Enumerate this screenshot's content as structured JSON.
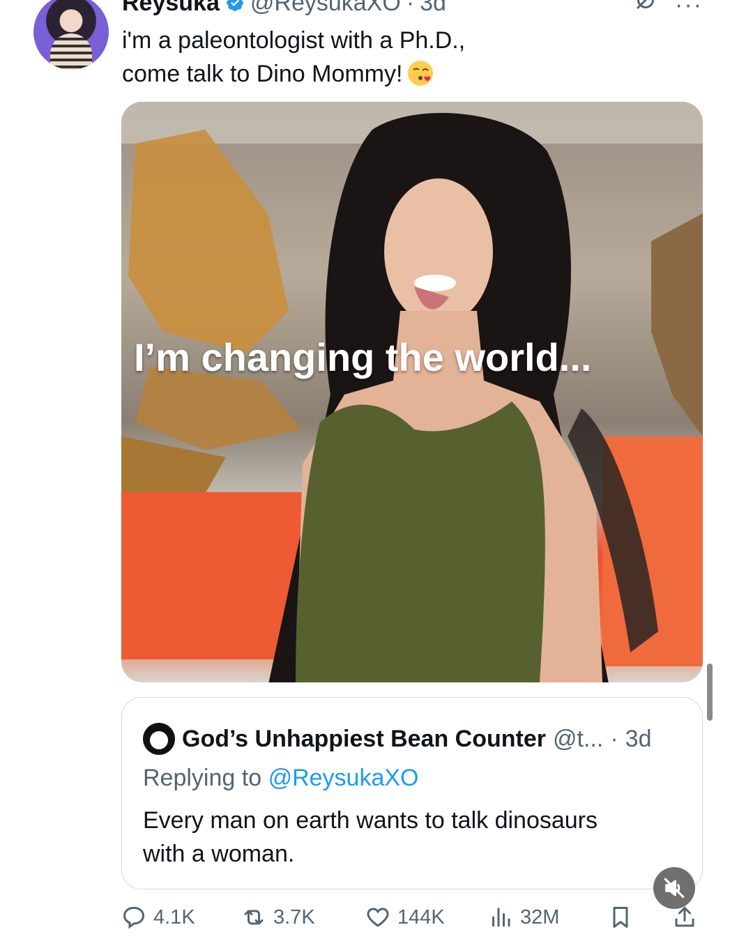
{
  "tweet": {
    "display_name": "Reysuka",
    "handle": "@ReysukaXO",
    "separator": "·",
    "time": "3d",
    "text_line1": "i'm a paleontologist with a Ph.D.,",
    "text_line2": "come talk to Dino Mommy!",
    "media_overlay_text": "I’m changing the world..."
  },
  "quote": {
    "display_name": "God’s Unhappiest Bean Counter",
    "handle": "@t...",
    "separator": "·",
    "time": "3d",
    "replying_prefix": "Replying to",
    "replying_to": "@ReysukaXO",
    "text_line1": "Every man on earth wants to talk dinosaurs",
    "text_line2": "with a woman."
  },
  "actions": {
    "replies": "4.1K",
    "reposts": "3.7K",
    "likes": "144K",
    "views": "32M"
  },
  "icons": {
    "verified": "verified-badge-icon",
    "grok": "grok-icon",
    "more": "more-icon",
    "emoji": "face-blowing-kiss-emoji",
    "mute": "muted-speaker-icon",
    "reply": "reply-icon",
    "repost": "repost-icon",
    "like": "heart-icon",
    "views": "views-chart-icon",
    "bookmark": "bookmark-icon",
    "share": "share-icon"
  },
  "colors": {
    "link": "#1d9bf0",
    "secondary_text": "#536471",
    "verified_badge": "#1d9bf0"
  }
}
